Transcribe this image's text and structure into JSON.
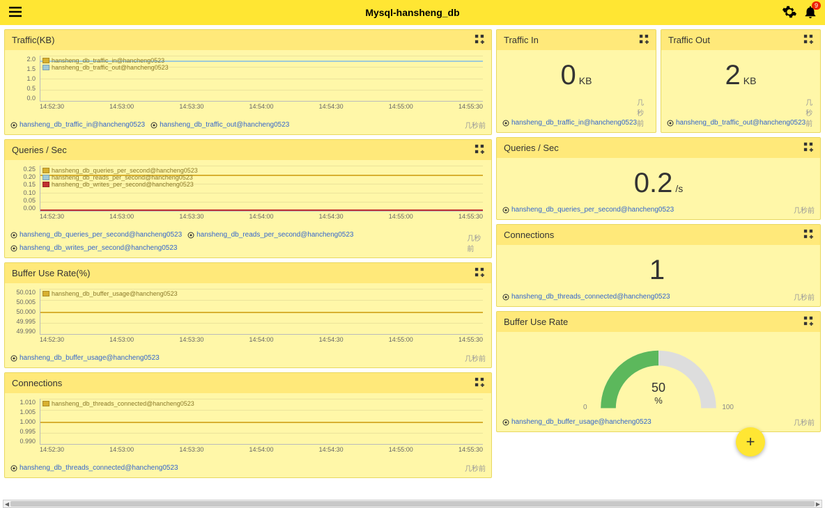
{
  "header": {
    "title": "Mysql-hansheng_db",
    "badge_count": "9"
  },
  "time_axis": [
    "14:52:30",
    "14:53:00",
    "14:53:30",
    "14:54:00",
    "14:54:30",
    "14:55:00",
    "14:55:30"
  ],
  "timestamp_label": "几秒前",
  "panels": {
    "traffic_chart": {
      "title": "Traffic(KB)",
      "y_ticks": [
        "2.0",
        "1.5",
        "1.0",
        "0.5",
        "0.0"
      ],
      "legend": [
        {
          "label": "hansheng_db_traffic_in@hancheng0523",
          "color": "#d8b030"
        },
        {
          "label": "hansheng_db_traffic_out@hancheng0523",
          "color": "#9fcad8"
        }
      ],
      "links": [
        "hansheng_db_traffic_in@hancheng0523",
        "hansheng_db_traffic_out@hancheng0523"
      ]
    },
    "traffic_in": {
      "title": "Traffic In",
      "value": "0",
      "unit": "KB",
      "link": "hansheng_db_traffic_in@hancheng0523"
    },
    "traffic_out": {
      "title": "Traffic Out",
      "value": "2",
      "unit": "KB",
      "link": "hansheng_db_traffic_out@hancheng0523"
    },
    "queries_chart": {
      "title": "Queries / Sec",
      "y_ticks": [
        "0.25",
        "0.20",
        "0.15",
        "0.10",
        "0.05",
        "0.00"
      ],
      "legend": [
        {
          "label": "hansheng_db_queries_per_second@hancheng0523",
          "color": "#d8b030"
        },
        {
          "label": "hansheng_db_reads_per_second@hancheng0523",
          "color": "#9fcad8"
        },
        {
          "label": "hansheng_db_writes_per_second@hancheng0523",
          "color": "#c03030"
        }
      ],
      "links": [
        "hansheng_db_queries_per_second@hancheng0523",
        "hansheng_db_reads_per_second@hancheng0523",
        "hansheng_db_writes_per_second@hancheng0523"
      ]
    },
    "queries_single": {
      "title": "Queries / Sec",
      "value": "0.2",
      "unit": "/s",
      "link": "hansheng_db_queries_per_second@hancheng0523"
    },
    "buffer_chart": {
      "title": "Buffer Use Rate(%)",
      "y_ticks": [
        "50.010",
        "50.005",
        "50.000",
        "49.995",
        "49.990"
      ],
      "legend": [
        {
          "label": "hansheng_db_buffer_usage@hancheng0523",
          "color": "#d8b030"
        }
      ],
      "links": [
        "hansheng_db_buffer_usage@hancheng0523"
      ]
    },
    "connections_single": {
      "title": "Connections",
      "value": "1",
      "unit": "",
      "link": "hansheng_db_threads_connected@hancheng0523"
    },
    "connections_chart": {
      "title": "Connections",
      "y_ticks": [
        "1.010",
        "1.005",
        "1.000",
        "0.995",
        "0.990"
      ],
      "legend": [
        {
          "label": "hansheng_db_threads_connected@hancheng0523",
          "color": "#d8b030"
        }
      ],
      "links": [
        "hansheng_db_threads_connected@hancheng0523"
      ]
    },
    "buffer_gauge": {
      "title": "Buffer Use Rate",
      "value": "50",
      "unit": "%",
      "min": "0",
      "max": "100",
      "link": "hansheng_db_buffer_usage@hancheng0523"
    }
  },
  "chart_data": [
    {
      "type": "line",
      "title": "Traffic(KB)",
      "x": [
        "14:52:30",
        "14:53:00",
        "14:53:30",
        "14:54:00",
        "14:54:30",
        "14:55:00",
        "14:55:30"
      ],
      "series": [
        {
          "name": "hansheng_db_traffic_in@hancheng0523",
          "values": [
            0,
            0,
            0,
            0,
            0,
            0,
            0
          ]
        },
        {
          "name": "hansheng_db_traffic_out@hancheng0523",
          "values": [
            1.8,
            1.8,
            1.8,
            1.8,
            1.8,
            1.8,
            1.8
          ]
        }
      ],
      "ylim": [
        0,
        2.0
      ],
      "ylabel": "KB"
    },
    {
      "type": "line",
      "title": "Queries / Sec",
      "x": [
        "14:52:30",
        "14:53:00",
        "14:53:30",
        "14:54:00",
        "14:54:30",
        "14:55:00",
        "14:55:30"
      ],
      "series": [
        {
          "name": "hansheng_db_queries_per_second@hancheng0523",
          "values": [
            0.2,
            0.2,
            0.2,
            0.2,
            0.2,
            0.2,
            0.2
          ]
        },
        {
          "name": "hansheng_db_reads_per_second@hancheng0523",
          "values": [
            0,
            0,
            0,
            0,
            0,
            0,
            0
          ]
        },
        {
          "name": "hansheng_db_writes_per_second@hancheng0523",
          "values": [
            0,
            0,
            0,
            0,
            0,
            0,
            0
          ]
        }
      ],
      "ylim": [
        0,
        0.25
      ],
      "ylabel": "/s"
    },
    {
      "type": "line",
      "title": "Buffer Use Rate(%)",
      "x": [
        "14:52:30",
        "14:53:00",
        "14:53:30",
        "14:54:00",
        "14:54:30",
        "14:55:00",
        "14:55:30"
      ],
      "series": [
        {
          "name": "hansheng_db_buffer_usage@hancheng0523",
          "values": [
            50,
            50,
            50,
            50,
            50,
            50,
            50
          ]
        }
      ],
      "ylim": [
        49.99,
        50.01
      ],
      "ylabel": "%"
    },
    {
      "type": "line",
      "title": "Connections",
      "x": [
        "14:52:30",
        "14:53:00",
        "14:53:30",
        "14:54:00",
        "14:54:30",
        "14:55:00",
        "14:55:30"
      ],
      "series": [
        {
          "name": "hansheng_db_threads_connected@hancheng0523",
          "values": [
            1,
            1,
            1,
            1,
            1,
            1,
            1
          ]
        }
      ],
      "ylim": [
        0.99,
        1.01
      ],
      "ylabel": ""
    },
    {
      "type": "gauge",
      "title": "Buffer Use Rate",
      "value": 50,
      "min": 0,
      "max": 100,
      "unit": "%"
    }
  ]
}
